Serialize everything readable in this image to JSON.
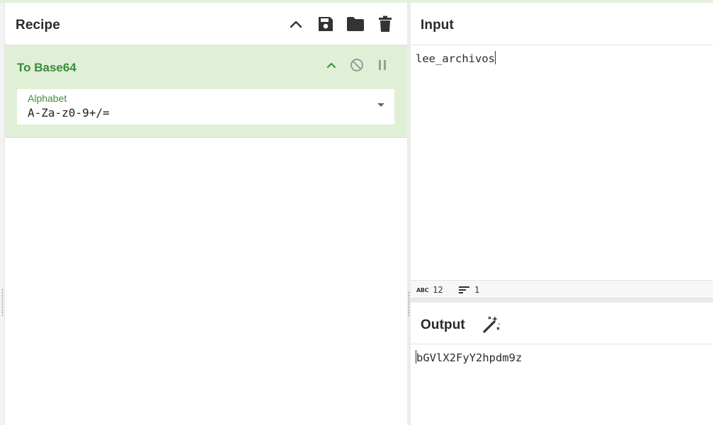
{
  "recipe": {
    "title": "Recipe",
    "toolbar_icons": [
      "chevron-up-icon",
      "save-icon",
      "folder-icon",
      "trash-icon"
    ],
    "operations": [
      {
        "name": "To Base64",
        "controls": [
          "chevron-up-icon",
          "disable-icon",
          "pause-icon"
        ],
        "args": [
          {
            "label": "Alphabet",
            "value": "A-Za-z0-9+/="
          }
        ]
      }
    ]
  },
  "input": {
    "title": "Input",
    "text": "lee_archivos",
    "status": {
      "length": "12",
      "lines": "1"
    }
  },
  "output": {
    "title": "Output",
    "text": "bGVlX2FyY2hpdm9z",
    "magic_icon": "magic-wand-icon"
  },
  "colors": {
    "operation_background": "#dff0d6",
    "operation_title": "#3a8a3a",
    "arg_label": "#3b8f3b"
  }
}
